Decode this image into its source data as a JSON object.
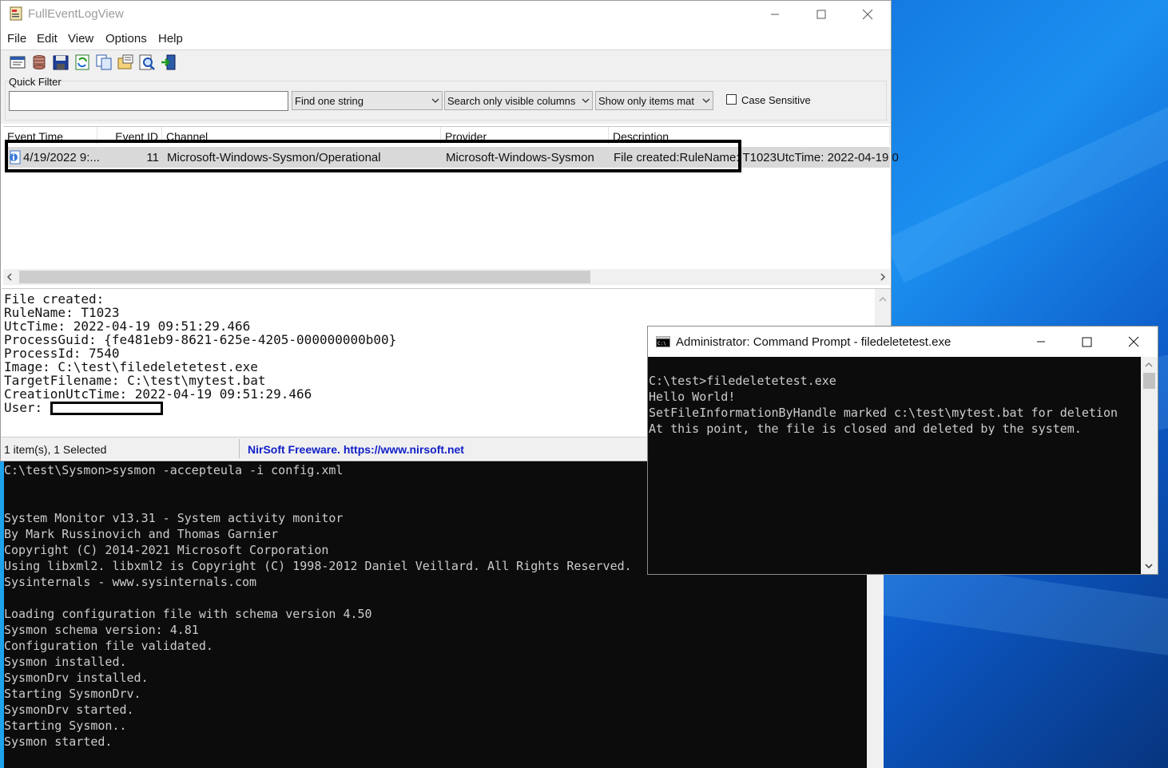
{
  "event_log_window": {
    "title": "FullEventLogView",
    "menu": [
      "File",
      "Edit",
      "View",
      "Options",
      "Help"
    ],
    "toolbar_icons": [
      "properties-icon",
      "data-source-icon",
      "save-icon",
      "refresh-icon",
      "copy-icon",
      "html-report-icon",
      "find-icon",
      "exit-icon"
    ],
    "quick_filter": {
      "label": "Quick Filter",
      "value": "",
      "mode": "Find one string",
      "scope": "Search only visible columns",
      "show": "Show only items mat",
      "case_sensitive_label": "Case Sensitive",
      "case_sensitive": false
    },
    "columns": [
      "Event Time",
      "Event ID",
      "Channel",
      "Provider",
      "Description"
    ],
    "rows": [
      {
        "event_time": "4/19/2022 9:...",
        "event_id": "11",
        "channel": "Microsoft-Windows-Sysmon/Operational",
        "provider": "Microsoft-Windows-Sysmon",
        "description": "File created:RuleName: T1023UtcTime: 2022-04-19 0"
      }
    ],
    "detail_lines": [
      "File created:",
      "RuleName: T1023",
      "UtcTime: 2022-04-19 09:51:29.466",
      "ProcessGuid: {fe481eb9-8621-625e-4205-000000000b00}",
      "ProcessId: 7540",
      "Image: C:\\test\\filedeletetest.exe",
      "TargetFilename: C:\\test\\mytest.bat",
      "CreationUtcTime: 2022-04-19 09:51:29.466",
      "User: "
    ],
    "status_left": "1 item(s), 1 Selected",
    "status_link": "NirSoft Freeware. https://www.nirsoft.net"
  },
  "cmd_window": {
    "title": "Administrator: Command Prompt - filedeletetest.exe",
    "lines": [
      "C:\\test>filedeletetest.exe",
      "Hello World!",
      "SetFileInformationByHandle marked c:\\test\\mytest.bat for deletion",
      "At this point, the file is closed and deleted by the system."
    ]
  },
  "back_console": {
    "lines": [
      "C:\\test\\Sysmon>sysmon -accepteula -i config.xml",
      "",
      "",
      "System Monitor v13.31 - System activity monitor",
      "By Mark Russinovich and Thomas Garnier",
      "Copyright (C) 2014-2021 Microsoft Corporation",
      "Using libxml2. libxml2 is Copyright (C) 1998-2012 Daniel Veillard. All Rights Reserved.",
      "Sysinternals - www.sysinternals.com",
      "",
      "Loading configuration file with schema version 4.50",
      "Sysmon schema version: 4.81",
      "Configuration file validated.",
      "Sysmon installed.",
      "SysmonDrv installed.",
      "Starting SysmonDrv.",
      "SysmonDrv started.",
      "Starting Sysmon..",
      "Sysmon started."
    ]
  }
}
